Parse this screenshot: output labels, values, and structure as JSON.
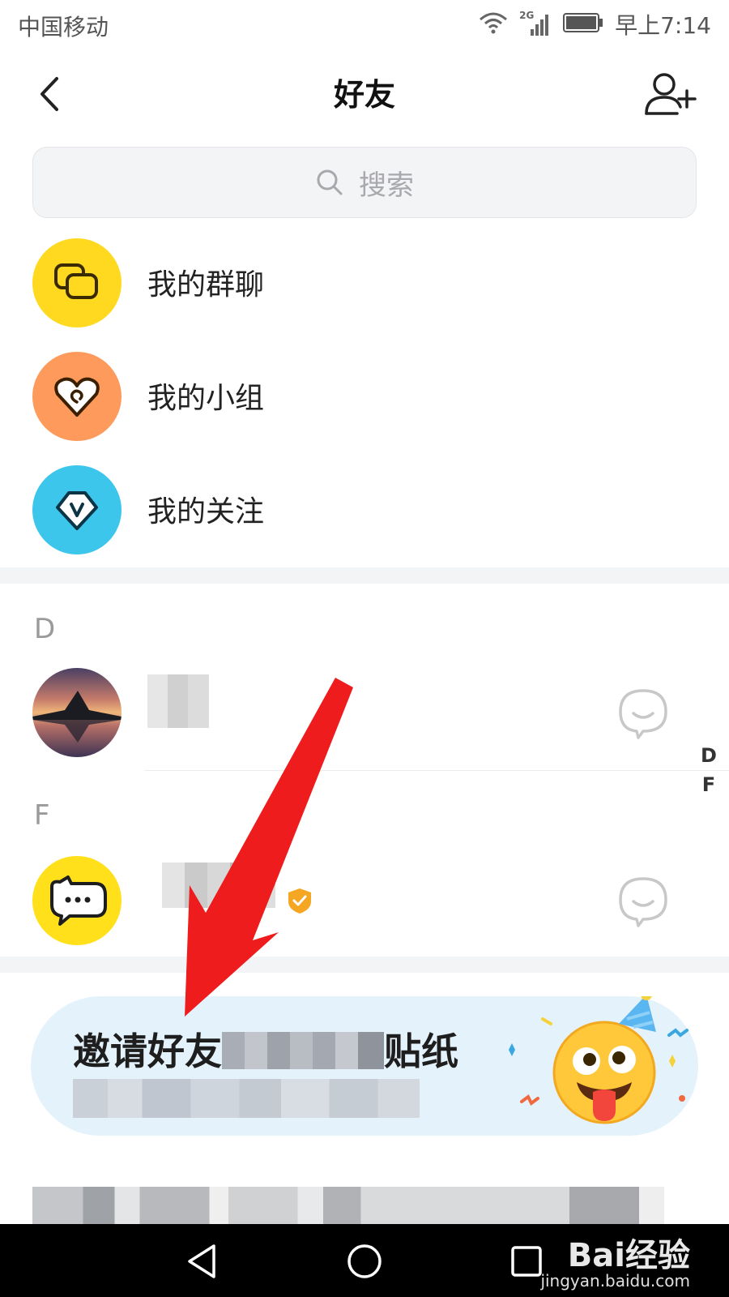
{
  "status_bar": {
    "carrier": "中国移动",
    "network": "2G",
    "time": "早上7:14"
  },
  "header": {
    "title": "好友"
  },
  "search": {
    "placeholder": "搜索"
  },
  "entries": [
    {
      "label": "我的群聊",
      "color": "#ffd91f",
      "icon": "chat-bubbles-icon"
    },
    {
      "label": "我的小组",
      "color": "#fd9a5c",
      "icon": "heart-swirl-icon"
    },
    {
      "label": "我的关注",
      "color": "#3cc6ec",
      "icon": "v-badge-icon"
    }
  ],
  "sections": [
    {
      "letter": "D"
    },
    {
      "letter": "F"
    }
  ],
  "index_letters": [
    "D",
    "F"
  ],
  "banner": {
    "title_start": "邀请好友",
    "title_end": "贴纸"
  },
  "watermark": {
    "logo": "Bai经验",
    "url": "jingyan.baidu.com"
  },
  "colors": {
    "accent_red": "#ee1c1c",
    "verified": "#f5a623",
    "separator": "#f3f4f6"
  }
}
